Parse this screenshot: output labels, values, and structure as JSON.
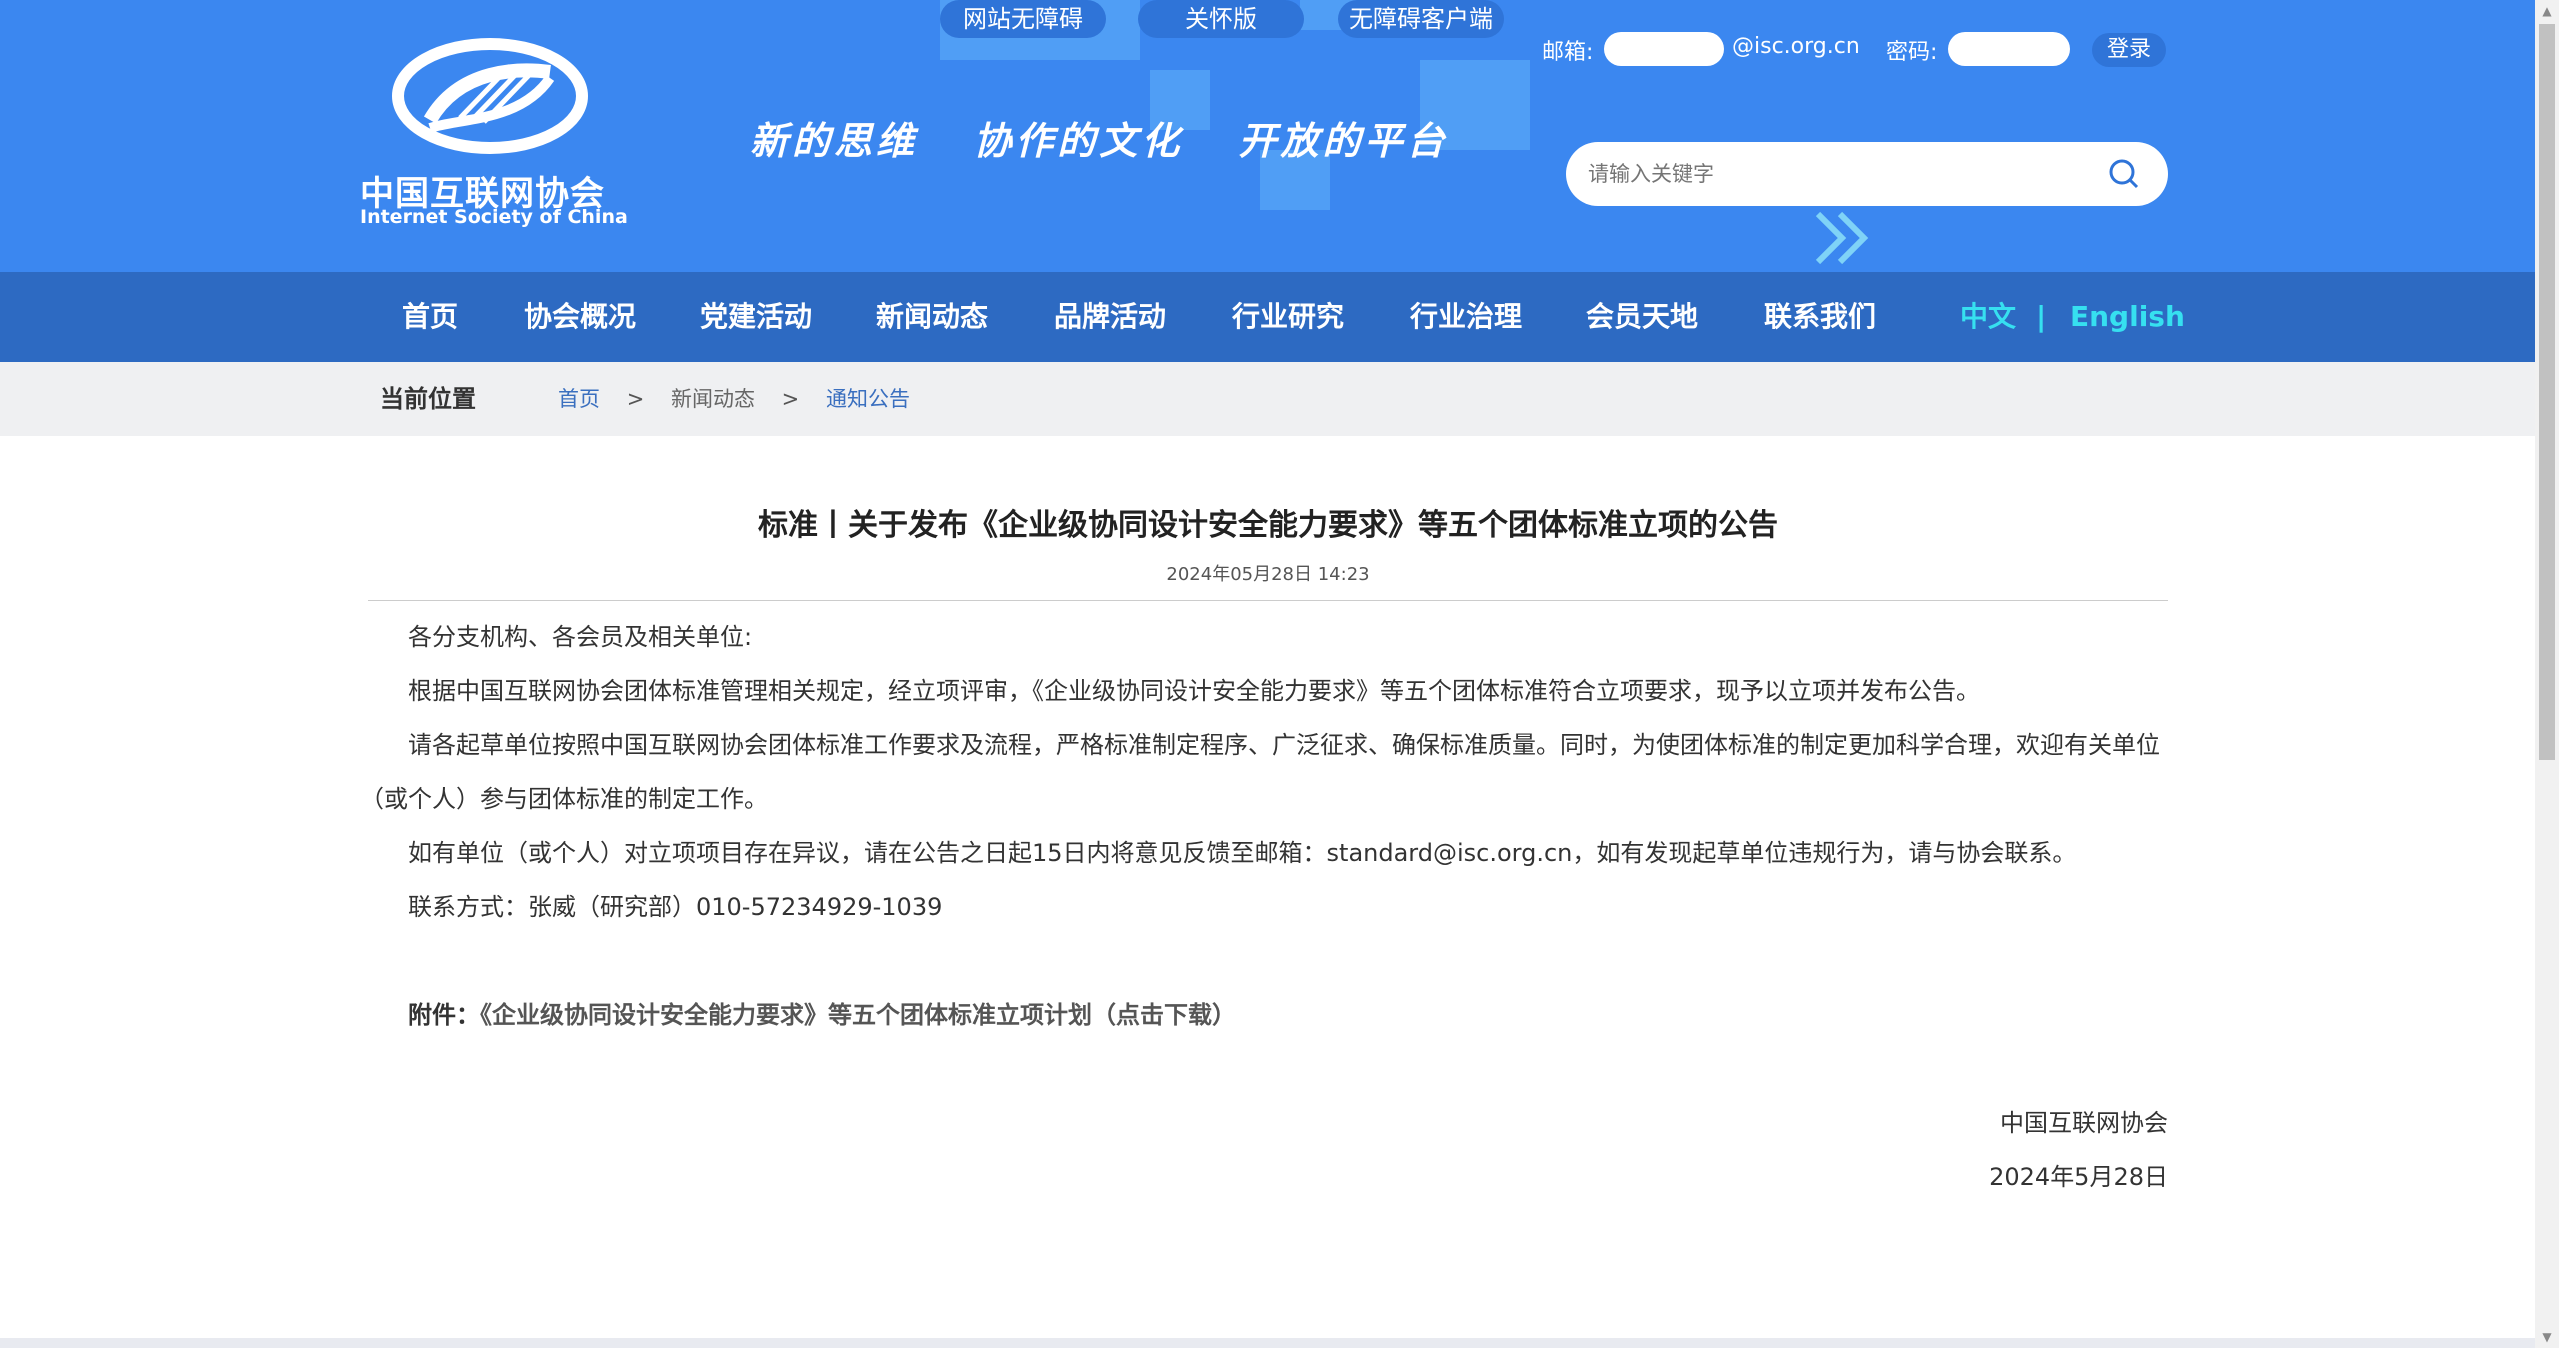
{
  "header": {
    "logo_cn": "中国互联网协会",
    "logo_en": "Internet Society of China",
    "slogan": [
      "新的思维",
      "协作的文化",
      "开放的平台"
    ],
    "top_links": [
      "网站无障碍",
      "关怀版",
      "无障碍客户端"
    ],
    "email_label": "邮箱:",
    "email_domain": "@isc.org.cn",
    "password_label": "密码:",
    "login_label": "登录",
    "search_placeholder": "请输入关键字"
  },
  "nav": {
    "items": [
      "首页",
      "协会概况",
      "党建活动",
      "新闻动态",
      "品牌活动",
      "行业研究",
      "行业治理",
      "会员天地",
      "联系我们"
    ],
    "lang_cn": "中文",
    "lang_sep": "|",
    "lang_en": "English"
  },
  "breadcrumb": {
    "title": "当前位置",
    "items": [
      "首页",
      "新闻动态",
      "通知公告"
    ],
    "sep": ">"
  },
  "article": {
    "title": "标准丨关于发布《企业级协同设计安全能力要求》等五个团体标准立项的公告",
    "date": "2024年05月28日 14:23",
    "paragraphs": [
      "各分支机构、各会员及相关单位:",
      "根据中国互联网协会团体标准管理相关规定，经立项评审，《企业级协同设计安全能力要求》等五个团体标准符合立项要求，现予以立项并发布公告。",
      "请各起草单位按照中国互联网协会团体标准工作要求及流程，严格标准制定程序、广泛征求、确保标准质量。同时，为使团体标准的制定更加科学合理，欢迎有关单位（或个人）参与团体标准的制定工作。",
      "如有单位（或个人）对立项项目存在异议，请在公告之日起15日内将意见反馈至邮箱：standard@isc.org.cn，如有发现起草单位违规行为，请与协会联系。",
      "联系方式：张威（研究部）010-57234929-1039"
    ],
    "attachment_label": "附件：",
    "attachment_link": "《企业级协同设计安全能力要求》等五个团体标准立项计划（点击下载）",
    "signoff_org": "中国互联网协会",
    "signoff_date": "2024年5月28日"
  },
  "colors": {
    "header_bg": "#3b87f0",
    "nav_bg": "#2d6ac2",
    "lang_accent": "#36e0f0",
    "breadcrumb_link": "#3a6fbf"
  }
}
